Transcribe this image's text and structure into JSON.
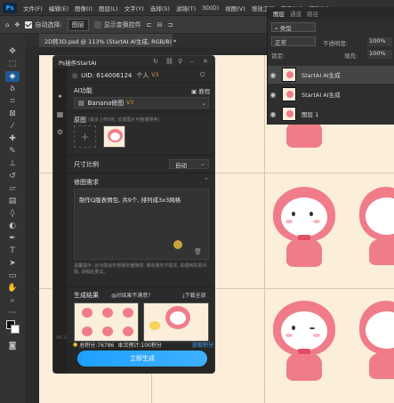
{
  "menubar": {
    "logo": "Ps",
    "items": [
      "文件(F)",
      "编辑(E)",
      "图像(I)",
      "图层(L)",
      "文字(Y)",
      "选择(S)",
      "滤镜(T)",
      "3D(D)",
      "视图(V)",
      "增效工具",
      "窗口(W)",
      "帮助(H)"
    ]
  },
  "optionsbar": {
    "auto_select_label": "自动选择:",
    "auto_select_value": "图层",
    "show_transform_label": "显示变换控件"
  },
  "document": {
    "tab_title": "2D转3D.psd @ 113% (StartAI AI生成, RGB/8) *"
  },
  "layers_panel": {
    "tabs": [
      "图层",
      "通道",
      "路径"
    ],
    "filter_label": "类型",
    "blend_mode": "正常",
    "opacity_label": "不透明度:",
    "opacity_value": "100%",
    "lock_label": "锁定:",
    "fill_label": "填充:",
    "fill_value": "100%",
    "layers": [
      {
        "name": "StartAI AI生成"
      },
      {
        "name": "StartAI AI生成"
      },
      {
        "name": "图层 1"
      }
    ]
  },
  "plugin": {
    "title": "Ps插件StartAI",
    "uid_label": "UID: 614006124",
    "user_type": "个人",
    "vip_badge": "V3",
    "ai_func_label": "AI功能",
    "tutorial_label": "教程",
    "function_value": "Banana修图",
    "function_badge": "V3",
    "source_label": "原图",
    "source_hint": "(最多上传5张, 长按图片可拖拽排序)",
    "ratio_label": "尺寸比例",
    "ratio_value": "自动",
    "requirement_label": "修图需求",
    "requirement_text": "制作Q版表情包, 共9个, 排列成3x3网格",
    "tip_text": "温馨提示: 此功能会外部服务器接收, 偶有服务不稳定, 如遇到失败问题, 请稍后重试。",
    "results_label": "生成结果",
    "unsatisfied_label": "对结果不满意?",
    "download_all_label": "下载全部",
    "points_label": "总积分:76786",
    "cost_label": "本次预计:100积分",
    "get_points_label": "获取积分",
    "generate_button": "立即生成",
    "version": "V6.26.4"
  },
  "colors": {
    "accent": "#1ea0ff",
    "canvas_bg": "#fbeedb",
    "hood_pink": "#f07c8a",
    "panel_dark": "#262626"
  }
}
